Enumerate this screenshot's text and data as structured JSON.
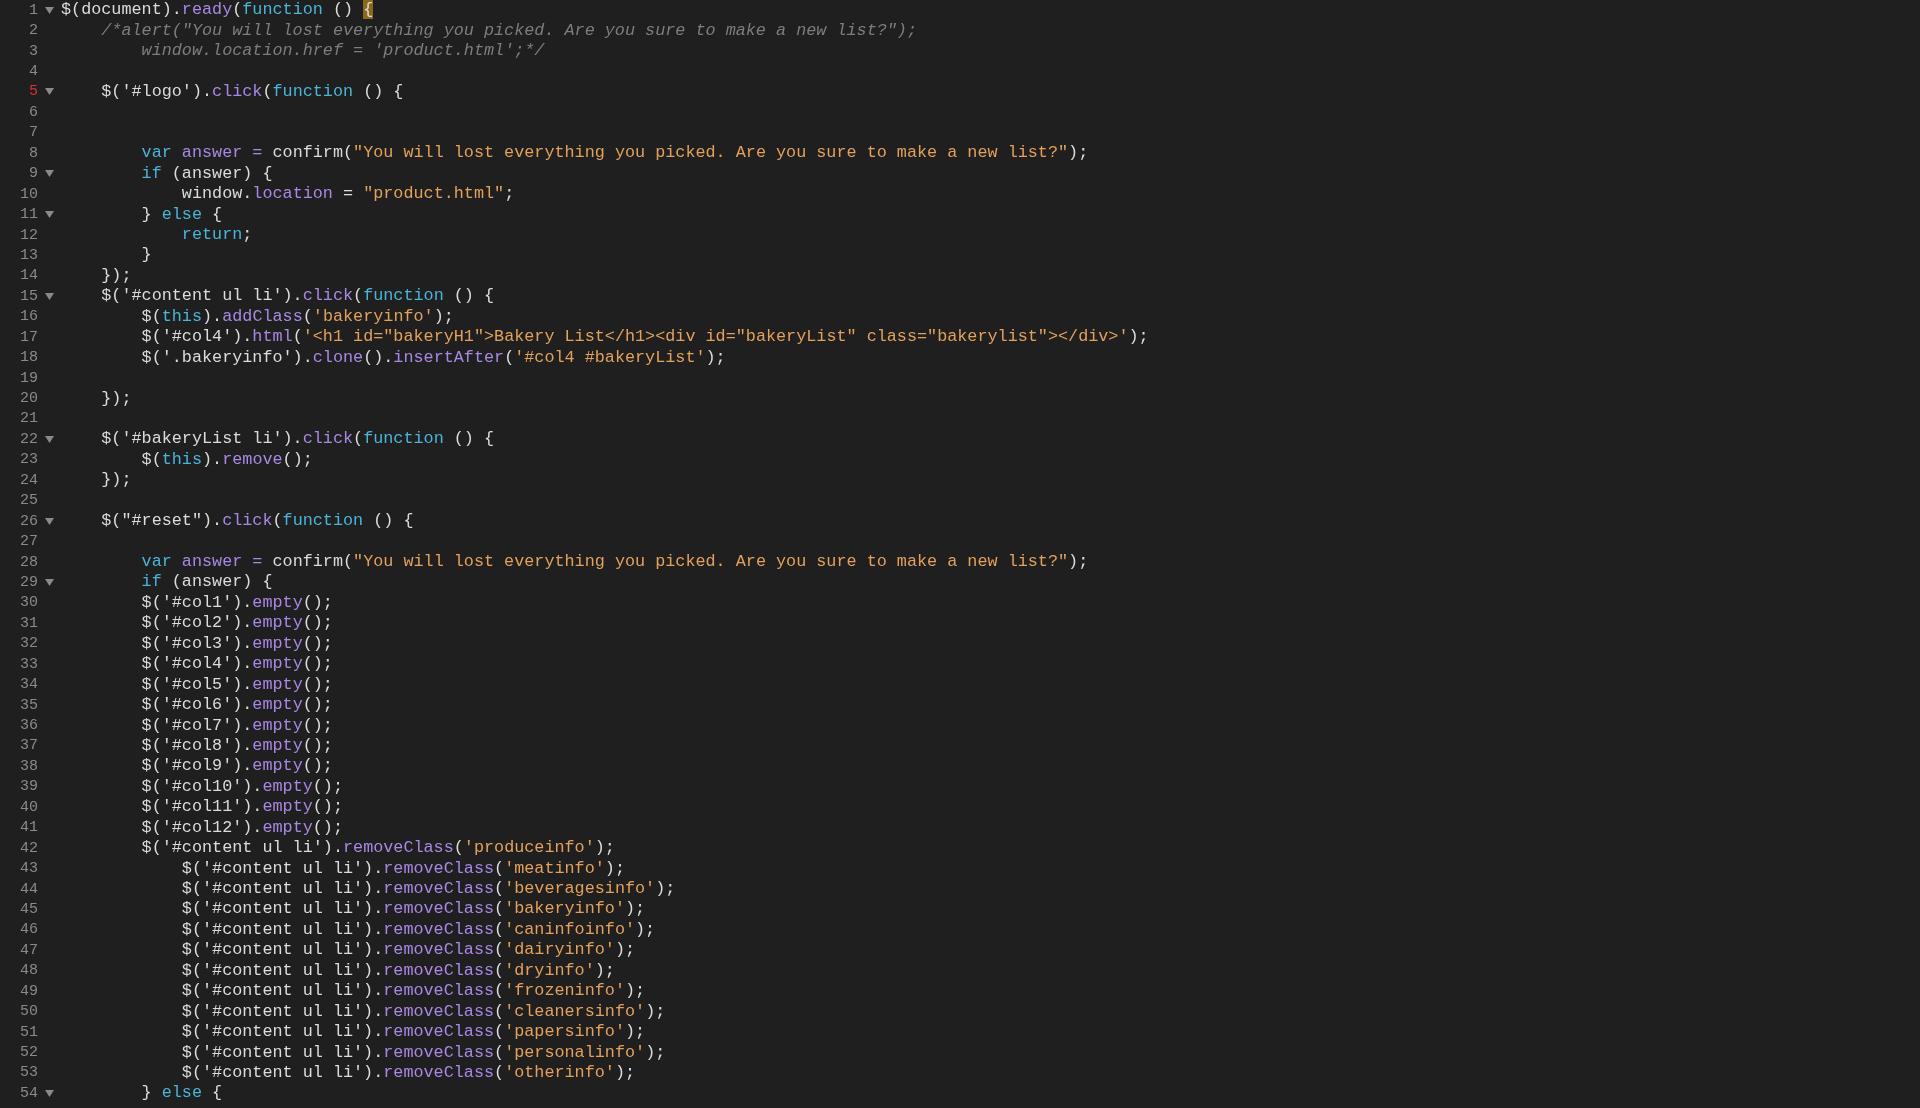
{
  "editor": {
    "lines": [
      {
        "number": "1",
        "fold": true,
        "marked": false,
        "tokens": [
          {
            "kind": "plain",
            "text": "$(document)."
          },
          {
            "kind": "method",
            "text": "ready"
          },
          {
            "kind": "plain",
            "text": "("
          },
          {
            "kind": "keyword",
            "text": "function"
          },
          {
            "kind": "plain",
            "text": " () "
          },
          {
            "kind": "match",
            "text": "{"
          }
        ]
      },
      {
        "number": "2",
        "fold": false,
        "marked": false,
        "tokens": [
          {
            "kind": "comment",
            "text": "    /*alert(\"You will lost everything you picked. Are you sure to make a new list?\");"
          }
        ]
      },
      {
        "number": "3",
        "fold": false,
        "marked": false,
        "tokens": [
          {
            "kind": "comment",
            "text": "        window.location.href = 'product.html';*/"
          }
        ]
      },
      {
        "number": "4",
        "fold": false,
        "marked": false
      },
      {
        "number": "5",
        "fold": true,
        "marked": true,
        "tokens": [
          {
            "kind": "plain",
            "text": "    $('#logo')."
          },
          {
            "kind": "method",
            "text": "click"
          },
          {
            "kind": "plain",
            "text": "("
          },
          {
            "kind": "keyword",
            "text": "function"
          },
          {
            "kind": "plain",
            "text": " () {"
          }
        ]
      },
      {
        "number": "6",
        "fold": false,
        "marked": false
      },
      {
        "number": "7",
        "fold": false,
        "marked": false
      },
      {
        "number": "8",
        "fold": false,
        "marked": false,
        "tokens": [
          {
            "kind": "keyword",
            "text": "        var"
          },
          {
            "kind": "method",
            "text": " answer ="
          },
          {
            "kind": "plain",
            "text": " confirm("
          },
          {
            "kind": "string",
            "text": "\"You will lost everything you picked. Are you sure to make a new list?\""
          },
          {
            "kind": "plain",
            "text": ");"
          }
        ]
      },
      {
        "number": "9",
        "fold": true,
        "marked": false,
        "tokens": [
          {
            "kind": "keyword",
            "text": "        if"
          },
          {
            "kind": "plain",
            "text": " (answer) {"
          }
        ]
      },
      {
        "number": "10",
        "fold": false,
        "marked": false,
        "tokens": [
          {
            "kind": "plain",
            "text": "            window."
          },
          {
            "kind": "method",
            "text": "location"
          },
          {
            "kind": "plain",
            "text": " = "
          },
          {
            "kind": "string",
            "text": "\"product.html\""
          },
          {
            "kind": "plain",
            "text": ";"
          }
        ]
      },
      {
        "number": "11",
        "fold": true,
        "marked": false,
        "tokens": [
          {
            "kind": "plain",
            "text": "        } "
          },
          {
            "kind": "keyword",
            "text": "else"
          },
          {
            "kind": "plain",
            "text": " {"
          }
        ]
      },
      {
        "number": "12",
        "fold": false,
        "marked": false,
        "tokens": [
          {
            "kind": "keyword",
            "text": "            return"
          },
          {
            "kind": "plain",
            "text": ";"
          }
        ]
      },
      {
        "number": "13",
        "fold": false,
        "marked": false,
        "tokens": [
          {
            "kind": "plain",
            "text": "        }"
          }
        ]
      },
      {
        "number": "14",
        "fold": false,
        "marked": false,
        "tokens": [
          {
            "kind": "plain",
            "text": "    });"
          }
        ]
      },
      {
        "number": "15",
        "fold": true,
        "marked": false,
        "tokens": [
          {
            "kind": "plain",
            "text": "    $('#content ul li')."
          },
          {
            "kind": "method",
            "text": "click"
          },
          {
            "kind": "plain",
            "text": "("
          },
          {
            "kind": "keyword",
            "text": "function"
          },
          {
            "kind": "plain",
            "text": " () {"
          }
        ]
      },
      {
        "number": "16",
        "fold": false,
        "marked": false,
        "tokens": [
          {
            "kind": "plain",
            "text": "        $("
          },
          {
            "kind": "keyword",
            "text": "this"
          },
          {
            "kind": "plain",
            "text": ")."
          },
          {
            "kind": "method",
            "text": "addClass"
          },
          {
            "kind": "plain",
            "text": "("
          },
          {
            "kind": "string",
            "text": "'bakeryinfo'"
          },
          {
            "kind": "plain",
            "text": ");"
          }
        ]
      },
      {
        "number": "17",
        "fold": false,
        "marked": false,
        "tokens": [
          {
            "kind": "plain",
            "text": "        $('#col4')."
          },
          {
            "kind": "method",
            "text": "html"
          },
          {
            "kind": "plain",
            "text": "("
          },
          {
            "kind": "string",
            "text": "'<h1 id=\"bakeryH1\">Bakery List</h1><div id=\"bakeryList\" class=\"bakerylist\"></div>'"
          },
          {
            "kind": "plain",
            "text": ");"
          }
        ]
      },
      {
        "number": "18",
        "fold": false,
        "marked": false,
        "tokens": [
          {
            "kind": "plain",
            "text": "        $('.bakeryinfo')."
          },
          {
            "kind": "method",
            "text": "clone"
          },
          {
            "kind": "plain",
            "text": "()."
          },
          {
            "kind": "method",
            "text": "insertAfter"
          },
          {
            "kind": "plain",
            "text": "("
          },
          {
            "kind": "string",
            "text": "'#col4 #bakeryList'"
          },
          {
            "kind": "plain",
            "text": ");"
          }
        ]
      },
      {
        "number": "19",
        "fold": false,
        "marked": false
      },
      {
        "number": "20",
        "fold": false,
        "marked": false,
        "tokens": [
          {
            "kind": "plain",
            "text": "    });"
          }
        ]
      },
      {
        "number": "21",
        "fold": false,
        "marked": false
      },
      {
        "number": "22",
        "fold": true,
        "marked": false,
        "tokens": [
          {
            "kind": "plain",
            "text": "    $('#bakeryList li')."
          },
          {
            "kind": "method",
            "text": "click"
          },
          {
            "kind": "plain",
            "text": "("
          },
          {
            "kind": "keyword",
            "text": "function"
          },
          {
            "kind": "plain",
            "text": " () {"
          }
        ]
      },
      {
        "number": "23",
        "fold": false,
        "marked": false,
        "tokens": [
          {
            "kind": "plain",
            "text": "        $("
          },
          {
            "kind": "keyword",
            "text": "this"
          },
          {
            "kind": "plain",
            "text": ")."
          },
          {
            "kind": "method",
            "text": "remove"
          },
          {
            "kind": "plain",
            "text": "();"
          }
        ]
      },
      {
        "number": "24",
        "fold": false,
        "marked": false,
        "tokens": [
          {
            "kind": "plain",
            "text": "    });"
          }
        ]
      },
      {
        "number": "25",
        "fold": false,
        "marked": false
      },
      {
        "number": "26",
        "fold": true,
        "marked": false,
        "tokens": [
          {
            "kind": "plain",
            "text": "    $(\"#reset\")."
          },
          {
            "kind": "method",
            "text": "click"
          },
          {
            "kind": "plain",
            "text": "("
          },
          {
            "kind": "keyword",
            "text": "function"
          },
          {
            "kind": "plain",
            "text": " () {"
          }
        ]
      },
      {
        "number": "27",
        "fold": false,
        "marked": false
      },
      {
        "number": "28",
        "fold": false,
        "marked": false,
        "tokens": [
          {
            "kind": "keyword",
            "text": "        var"
          },
          {
            "kind": "method",
            "text": " answer ="
          },
          {
            "kind": "plain",
            "text": " confirm("
          },
          {
            "kind": "string",
            "text": "\"You will lost everything you picked. Are you sure to make a new list?\""
          },
          {
            "kind": "plain",
            "text": ");"
          }
        ]
      },
      {
        "number": "29",
        "fold": true,
        "marked": false,
        "tokens": [
          {
            "kind": "keyword",
            "text": "        if"
          },
          {
            "kind": "plain",
            "text": " (answer) {"
          }
        ]
      },
      {
        "number": "30",
        "fold": false,
        "marked": false,
        "tokens": [
          {
            "kind": "plain",
            "text": "        $('#col1')."
          },
          {
            "kind": "method",
            "text": "empty"
          },
          {
            "kind": "plain",
            "text": "();"
          }
        ]
      },
      {
        "number": "31",
        "fold": false,
        "marked": false,
        "tokens": [
          {
            "kind": "plain",
            "text": "        $('#col2')."
          },
          {
            "kind": "method",
            "text": "empty"
          },
          {
            "kind": "plain",
            "text": "();"
          }
        ]
      },
      {
        "number": "32",
        "fold": false,
        "marked": false,
        "tokens": [
          {
            "kind": "plain",
            "text": "        $('#col3')."
          },
          {
            "kind": "method",
            "text": "empty"
          },
          {
            "kind": "plain",
            "text": "();"
          }
        ]
      },
      {
        "number": "33",
        "fold": false,
        "marked": false,
        "tokens": [
          {
            "kind": "plain",
            "text": "        $('#col4')."
          },
          {
            "kind": "method",
            "text": "empty"
          },
          {
            "kind": "plain",
            "text": "();"
          }
        ]
      },
      {
        "number": "34",
        "fold": false,
        "marked": false,
        "tokens": [
          {
            "kind": "plain",
            "text": "        $('#col5')."
          },
          {
            "kind": "method",
            "text": "empty"
          },
          {
            "kind": "plain",
            "text": "();"
          }
        ]
      },
      {
        "number": "35",
        "fold": false,
        "marked": false,
        "tokens": [
          {
            "kind": "plain",
            "text": "        $('#col6')."
          },
          {
            "kind": "method",
            "text": "empty"
          },
          {
            "kind": "plain",
            "text": "();"
          }
        ]
      },
      {
        "number": "36",
        "fold": false,
        "marked": false,
        "tokens": [
          {
            "kind": "plain",
            "text": "        $('#col7')."
          },
          {
            "kind": "method",
            "text": "empty"
          },
          {
            "kind": "plain",
            "text": "();"
          }
        ]
      },
      {
        "number": "37",
        "fold": false,
        "marked": false,
        "tokens": [
          {
            "kind": "plain",
            "text": "        $('#col8')."
          },
          {
            "kind": "method",
            "text": "empty"
          },
          {
            "kind": "plain",
            "text": "();"
          }
        ]
      },
      {
        "number": "38",
        "fold": false,
        "marked": false,
        "tokens": [
          {
            "kind": "plain",
            "text": "        $('#col9')."
          },
          {
            "kind": "method",
            "text": "empty"
          },
          {
            "kind": "plain",
            "text": "();"
          }
        ]
      },
      {
        "number": "39",
        "fold": false,
        "marked": false,
        "tokens": [
          {
            "kind": "plain",
            "text": "        $('#col10')."
          },
          {
            "kind": "method",
            "text": "empty"
          },
          {
            "kind": "plain",
            "text": "();"
          }
        ]
      },
      {
        "number": "40",
        "fold": false,
        "marked": false,
        "tokens": [
          {
            "kind": "plain",
            "text": "        $('#col11')."
          },
          {
            "kind": "method",
            "text": "empty"
          },
          {
            "kind": "plain",
            "text": "();"
          }
        ]
      },
      {
        "number": "41",
        "fold": false,
        "marked": false,
        "tokens": [
          {
            "kind": "plain",
            "text": "        $('#col12')."
          },
          {
            "kind": "method",
            "text": "empty"
          },
          {
            "kind": "plain",
            "text": "();"
          }
        ]
      },
      {
        "number": "42",
        "fold": false,
        "marked": false,
        "tokens": [
          {
            "kind": "plain",
            "text": "        $('#content ul li')."
          },
          {
            "kind": "method",
            "text": "removeClass"
          },
          {
            "kind": "plain",
            "text": "("
          },
          {
            "kind": "string",
            "text": "'produceinfo'"
          },
          {
            "kind": "plain",
            "text": ");"
          }
        ]
      },
      {
        "number": "43",
        "fold": false,
        "marked": false,
        "tokens": [
          {
            "kind": "plain",
            "text": "            $('#content ul li')."
          },
          {
            "kind": "method",
            "text": "removeClass"
          },
          {
            "kind": "plain",
            "text": "("
          },
          {
            "kind": "string",
            "text": "'meatinfo'"
          },
          {
            "kind": "plain",
            "text": ");"
          }
        ]
      },
      {
        "number": "44",
        "fold": false,
        "marked": false,
        "tokens": [
          {
            "kind": "plain",
            "text": "            $('#content ul li')."
          },
          {
            "kind": "method",
            "text": "removeClass"
          },
          {
            "kind": "plain",
            "text": "("
          },
          {
            "kind": "string",
            "text": "'beveragesinfo'"
          },
          {
            "kind": "plain",
            "text": ");"
          }
        ]
      },
      {
        "number": "45",
        "fold": false,
        "marked": false,
        "tokens": [
          {
            "kind": "plain",
            "text": "            $('#content ul li')."
          },
          {
            "kind": "method",
            "text": "removeClass"
          },
          {
            "kind": "plain",
            "text": "("
          },
          {
            "kind": "string",
            "text": "'bakeryinfo'"
          },
          {
            "kind": "plain",
            "text": ");"
          }
        ]
      },
      {
        "number": "46",
        "fold": false,
        "marked": false,
        "tokens": [
          {
            "kind": "plain",
            "text": "            $('#content ul li')."
          },
          {
            "kind": "method",
            "text": "removeClass"
          },
          {
            "kind": "plain",
            "text": "("
          },
          {
            "kind": "string",
            "text": "'caninfoinfo'"
          },
          {
            "kind": "plain",
            "text": ");"
          }
        ]
      },
      {
        "number": "47",
        "fold": false,
        "marked": false,
        "tokens": [
          {
            "kind": "plain",
            "text": "            $('#content ul li')."
          },
          {
            "kind": "method",
            "text": "removeClass"
          },
          {
            "kind": "plain",
            "text": "("
          },
          {
            "kind": "string",
            "text": "'dairyinfo'"
          },
          {
            "kind": "plain",
            "text": ");"
          }
        ]
      },
      {
        "number": "48",
        "fold": false,
        "marked": false,
        "tokens": [
          {
            "kind": "plain",
            "text": "            $('#content ul li')."
          },
          {
            "kind": "method",
            "text": "removeClass"
          },
          {
            "kind": "plain",
            "text": "("
          },
          {
            "kind": "string",
            "text": "'dryinfo'"
          },
          {
            "kind": "plain",
            "text": ");"
          }
        ]
      },
      {
        "number": "49",
        "fold": false,
        "marked": false,
        "tokens": [
          {
            "kind": "plain",
            "text": "            $('#content ul li')."
          },
          {
            "kind": "method",
            "text": "removeClass"
          },
          {
            "kind": "plain",
            "text": "("
          },
          {
            "kind": "string",
            "text": "'frozeninfo'"
          },
          {
            "kind": "plain",
            "text": ");"
          }
        ]
      },
      {
        "number": "50",
        "fold": false,
        "marked": false,
        "tokens": [
          {
            "kind": "plain",
            "text": "            $('#content ul li')."
          },
          {
            "kind": "method",
            "text": "removeClass"
          },
          {
            "kind": "plain",
            "text": "("
          },
          {
            "kind": "string",
            "text": "'cleanersinfo'"
          },
          {
            "kind": "plain",
            "text": ");"
          }
        ]
      },
      {
        "number": "51",
        "fold": false,
        "marked": false,
        "tokens": [
          {
            "kind": "plain",
            "text": "            $('#content ul li')."
          },
          {
            "kind": "method",
            "text": "removeClass"
          },
          {
            "kind": "plain",
            "text": "("
          },
          {
            "kind": "string",
            "text": "'papersinfo'"
          },
          {
            "kind": "plain",
            "text": ");"
          }
        ]
      },
      {
        "number": "52",
        "fold": false,
        "marked": false,
        "tokens": [
          {
            "kind": "plain",
            "text": "            $('#content ul li')."
          },
          {
            "kind": "method",
            "text": "removeClass"
          },
          {
            "kind": "plain",
            "text": "("
          },
          {
            "kind": "string",
            "text": "'personalinfo'"
          },
          {
            "kind": "plain",
            "text": ");"
          }
        ]
      },
      {
        "number": "53",
        "fold": false,
        "marked": false,
        "tokens": [
          {
            "kind": "plain",
            "text": "            $('#content ul li')."
          },
          {
            "kind": "method",
            "text": "removeClass"
          },
          {
            "kind": "plain",
            "text": "("
          },
          {
            "kind": "string",
            "text": "'otherinfo'"
          },
          {
            "kind": "plain",
            "text": ");"
          }
        ]
      },
      {
        "number": "54",
        "fold": true,
        "marked": false,
        "tokens": [
          {
            "kind": "plain",
            "text": "        } "
          },
          {
            "kind": "keyword",
            "text": "else"
          },
          {
            "kind": "plain",
            "text": " {"
          }
        ]
      }
    ]
  }
}
